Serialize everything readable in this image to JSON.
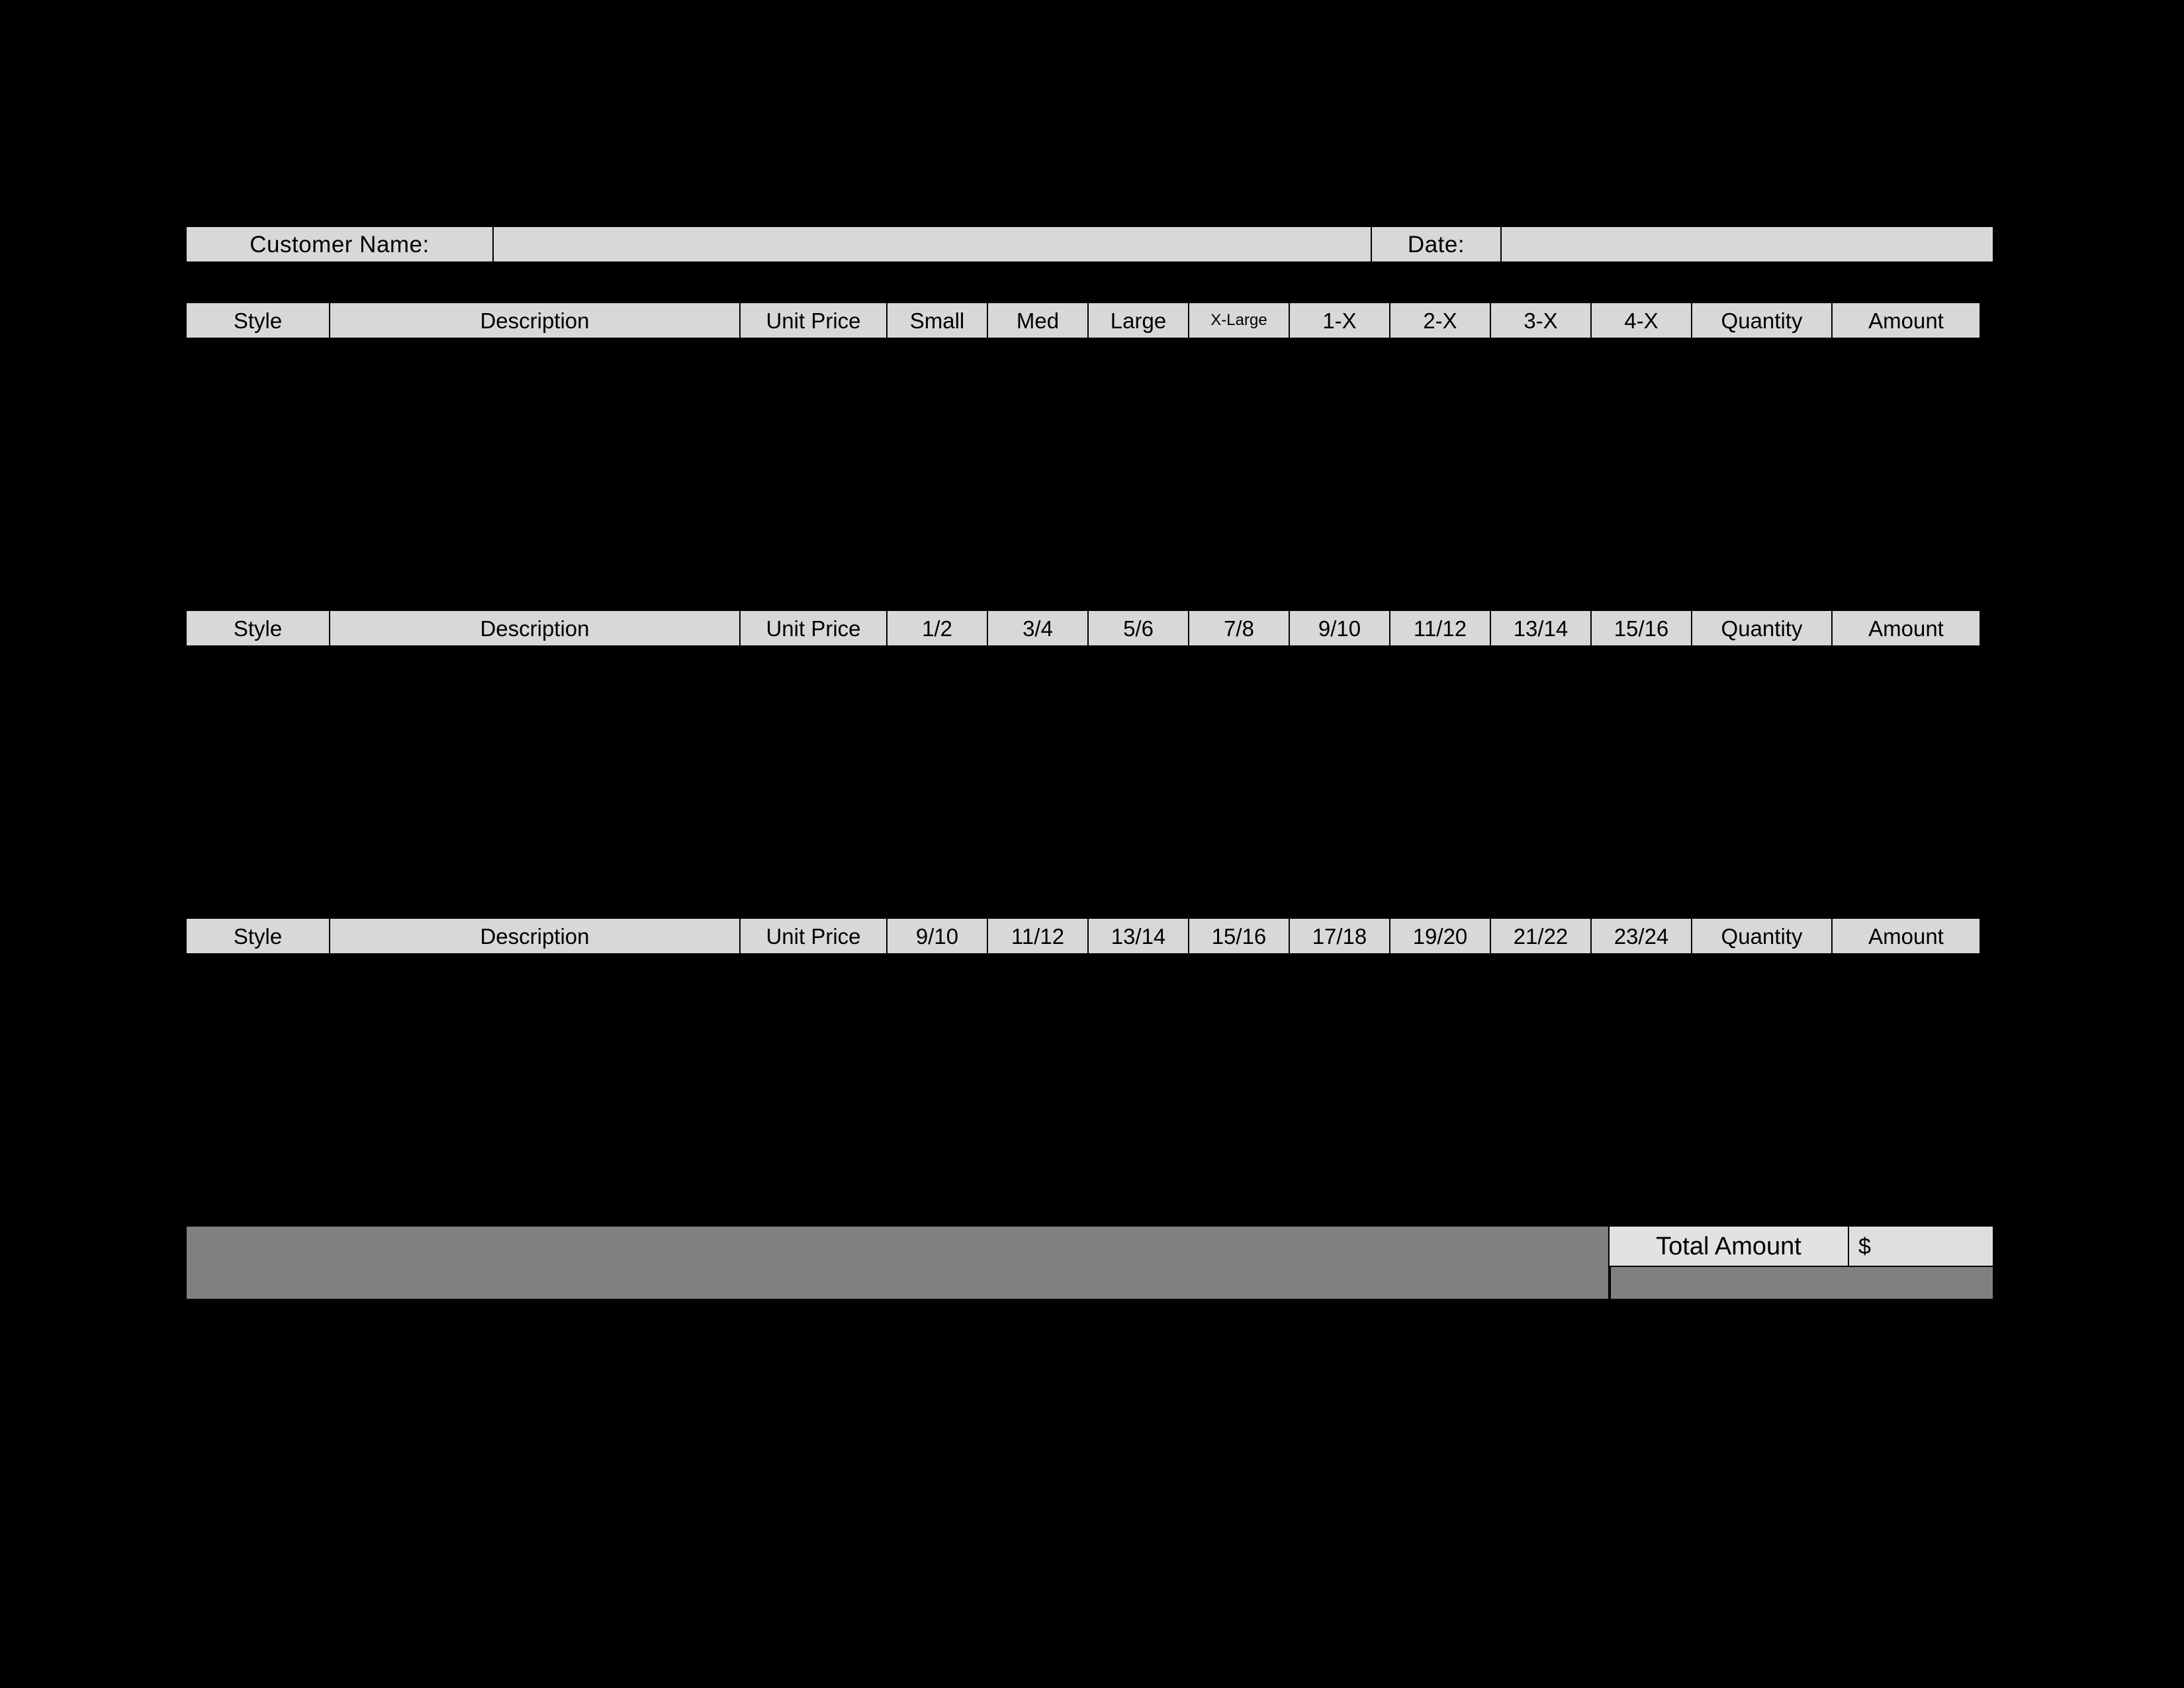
{
  "form": {
    "customer_label": "Customer Name:",
    "customer_value": "",
    "date_label": "Date:",
    "date_value": ""
  },
  "colors": {
    "page_background": "#000000",
    "cell_fill": "#d8d8d8",
    "total_fill": "#e2e2e2",
    "total_value_fill": "#dedede",
    "spacer_gray": "#808080",
    "border": "#000000",
    "text": "#000000"
  },
  "tables": [
    {
      "name": "adult-sizes",
      "columns": [
        {
          "key": "style",
          "label": "Style",
          "width_class": "col-style"
        },
        {
          "key": "desc",
          "label": "Description",
          "width_class": "col-desc"
        },
        {
          "key": "price",
          "label": "Unit Price",
          "width_class": "col-price"
        },
        {
          "key": "s1",
          "label": "Small",
          "width_class": "col-sz"
        },
        {
          "key": "s2",
          "label": "Med",
          "width_class": "col-sz"
        },
        {
          "key": "s3",
          "label": "Large",
          "width_class": "col-sz"
        },
        {
          "key": "s4",
          "label": "X-Large",
          "width_class": "col-sz",
          "small": true
        },
        {
          "key": "s5",
          "label": "1-X",
          "width_class": "col-sz"
        },
        {
          "key": "s6",
          "label": "2-X",
          "width_class": "col-sz"
        },
        {
          "key": "s7",
          "label": "3-X",
          "width_class": "col-sz"
        },
        {
          "key": "s8",
          "label": "4-X",
          "width_class": "col-sz"
        },
        {
          "key": "quantity",
          "label": "Quantity",
          "width_class": "col-qty"
        },
        {
          "key": "amount",
          "label": "Amount",
          "width_class": "col-amt"
        }
      ],
      "rows": []
    },
    {
      "name": "youth-sizes",
      "columns": [
        {
          "key": "style",
          "label": "Style",
          "width_class": "col-style"
        },
        {
          "key": "desc",
          "label": "Description",
          "width_class": "col-desc"
        },
        {
          "key": "price",
          "label": "Unit Price",
          "width_class": "col-price"
        },
        {
          "key": "s1",
          "label": "1/2",
          "width_class": "col-sz"
        },
        {
          "key": "s2",
          "label": "3/4",
          "width_class": "col-sz"
        },
        {
          "key": "s3",
          "label": "5/6",
          "width_class": "col-sz"
        },
        {
          "key": "s4",
          "label": "7/8",
          "width_class": "col-sz"
        },
        {
          "key": "s5",
          "label": "9/10",
          "width_class": "col-sz"
        },
        {
          "key": "s6",
          "label": "11/12",
          "width_class": "col-sz"
        },
        {
          "key": "s7",
          "label": "13/14",
          "width_class": "col-sz"
        },
        {
          "key": "s8",
          "label": "15/16",
          "width_class": "col-sz"
        },
        {
          "key": "quantity",
          "label": "Quantity",
          "width_class": "col-qty"
        },
        {
          "key": "amount",
          "label": "Amount",
          "width_class": "col-amt"
        }
      ],
      "rows": []
    },
    {
      "name": "junior-sizes",
      "columns": [
        {
          "key": "style",
          "label": "Style",
          "width_class": "col-style"
        },
        {
          "key": "desc",
          "label": "Description",
          "width_class": "col-desc"
        },
        {
          "key": "price",
          "label": "Unit Price",
          "width_class": "col-price"
        },
        {
          "key": "s1",
          "label": "9/10",
          "width_class": "col-sz"
        },
        {
          "key": "s2",
          "label": "11/12",
          "width_class": "col-sz"
        },
        {
          "key": "s3",
          "label": "13/14",
          "width_class": "col-sz"
        },
        {
          "key": "s4",
          "label": "15/16",
          "width_class": "col-sz"
        },
        {
          "key": "s5",
          "label": "17/18",
          "width_class": "col-sz"
        },
        {
          "key": "s6",
          "label": "19/20",
          "width_class": "col-sz"
        },
        {
          "key": "s7",
          "label": "21/22",
          "width_class": "col-sz"
        },
        {
          "key": "s8",
          "label": "23/24",
          "width_class": "col-sz"
        },
        {
          "key": "quantity",
          "label": "Quantity",
          "width_class": "col-qty"
        },
        {
          "key": "amount",
          "label": "Amount",
          "width_class": "col-amt"
        }
      ],
      "rows": []
    }
  ],
  "totals": {
    "label": "Total Amount",
    "currency_symbol": "$",
    "value": ""
  }
}
